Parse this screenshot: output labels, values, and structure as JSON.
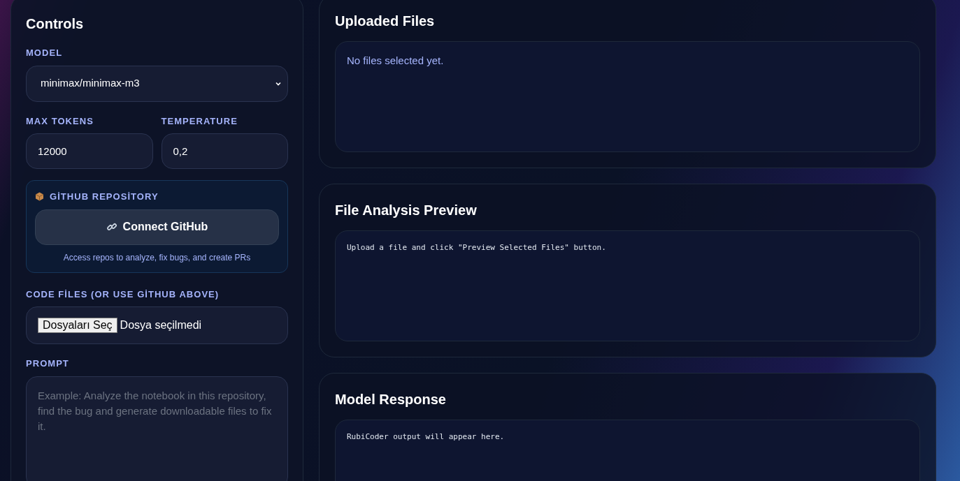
{
  "controls": {
    "title": "Controls",
    "model": {
      "label": "MODEL",
      "value": "minimax/minimax-m3"
    },
    "max_tokens": {
      "label": "MAX TOKENS",
      "value": "12000"
    },
    "temperature": {
      "label": "TEMPERATURE",
      "value": "0,2"
    },
    "github": {
      "label": "GİTHUB REPOSİTORY",
      "button": "Connect GitHub",
      "hint": "Access repos to analyze, fix bugs, and create PRs"
    },
    "code_files": {
      "label": "CODE FİLES (OR USE GİTHUB ABOVE)",
      "button": "Dosyaları Seç",
      "status": "Dosya seçilmedi"
    },
    "prompt": {
      "label": "PROMPT",
      "placeholder": "Example: Analyze the notebook in this repository, find the bug and generate downloadable files to fix it."
    }
  },
  "panels": [
    {
      "kind": "files",
      "title": "Uploaded Files",
      "text": "No files selected yet."
    },
    {
      "kind": "code",
      "title": "File Analysis Preview",
      "text": "Upload a file and click \"Preview Selected Files\" button."
    },
    {
      "kind": "code",
      "title": "Model Response",
      "text": "RubiCoder output will appear here."
    }
  ]
}
